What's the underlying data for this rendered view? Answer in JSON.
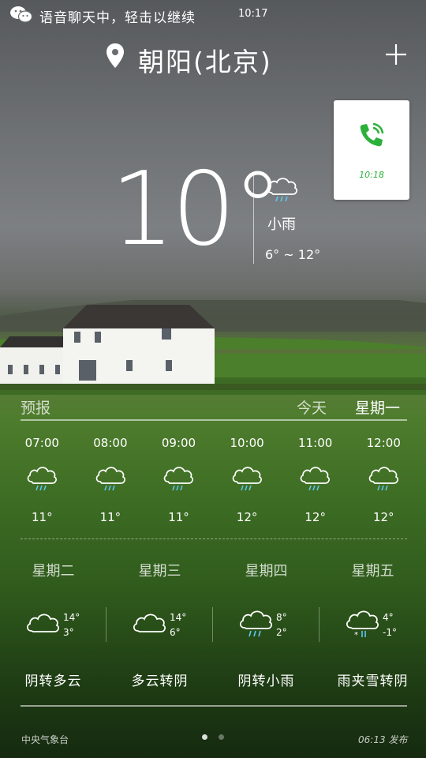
{
  "status_bar": {
    "voice_chat_text": "语音聊天中，轻击以继续",
    "time": "10:17",
    "app_icon": "wechat-icon"
  },
  "header": {
    "location_icon": "location-pin-icon",
    "location": "朝阳(北京)",
    "add_icon": "plus-icon"
  },
  "call_card": {
    "icon": "phone-call-icon",
    "time": "10:18",
    "accent": "#2bb03a"
  },
  "current": {
    "temperature": "10°",
    "condition_icon": "light-rain-icon",
    "condition": "小雨",
    "range": "6° ~ 12°"
  },
  "forecast_header": {
    "label": "预报",
    "today": "今天",
    "weekday": "星期一"
  },
  "hourly": [
    {
      "time": "07:00",
      "icon": "rain-cloud-icon",
      "temp": "11°"
    },
    {
      "time": "08:00",
      "icon": "rain-cloud-icon",
      "temp": "11°"
    },
    {
      "time": "09:00",
      "icon": "rain-cloud-icon",
      "temp": "11°"
    },
    {
      "time": "10:00",
      "icon": "rain-cloud-icon",
      "temp": "12°"
    },
    {
      "time": "11:00",
      "icon": "rain-cloud-icon",
      "temp": "12°"
    },
    {
      "time": "12:00",
      "icon": "rain-cloud-icon",
      "temp": "12°"
    }
  ],
  "daily": [
    {
      "day": "星期二",
      "icon": "cloud-icon",
      "high": "14°",
      "low": "3°",
      "desc": "阴转多云"
    },
    {
      "day": "星期三",
      "icon": "cloud-icon",
      "high": "14°",
      "low": "6°",
      "desc": "多云转阴"
    },
    {
      "day": "星期四",
      "icon": "rain-cloud-icon",
      "high": "8°",
      "low": "2°",
      "desc": "阴转小雨"
    },
    {
      "day": "星期五",
      "icon": "sleet-cloud-icon",
      "high": "4°",
      "low": "-1°",
      "desc": "雨夹雪转阴"
    }
  ],
  "footer": {
    "source": "中央气象台",
    "published": "06:13 发布",
    "page_count": 2,
    "active_page": 1
  },
  "colors": {
    "rain_drop": "#5fc8f0",
    "snow": "#ffffff"
  }
}
